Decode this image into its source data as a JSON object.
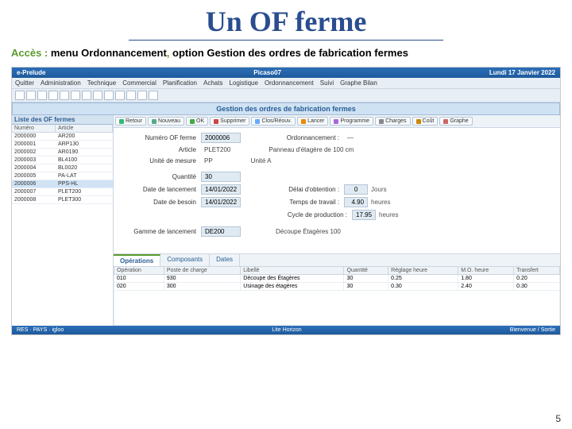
{
  "slide": {
    "title": "Un OF ferme",
    "prefix": "Accès : ",
    "strong1": "menu Ordonnancement",
    "comma": ", ",
    "strong2": "option Gestion des ordres de fabrication fermes",
    "page": "5"
  },
  "topbar": {
    "left": "e-Prelude",
    "center": "Picaso07",
    "right": "Lundi 17 Janvier 2022"
  },
  "menu": [
    "Quitter",
    "Administration",
    "Technique",
    "Commercial",
    "Planification",
    "Achats",
    "Logistique",
    "Ordonnancement",
    "Suivi",
    "Graphe Bilan"
  ],
  "pageHeader": "Gestion des ordres de fabrication fermes",
  "sidebar": {
    "title": "Liste des OF fermes",
    "cols": {
      "c1": "Numéro",
      "c2": "Article"
    },
    "rows": [
      {
        "n": "2000000",
        "a": "AR200"
      },
      {
        "n": "2000001",
        "a": "ARP130"
      },
      {
        "n": "2000002",
        "a": "AR0190"
      },
      {
        "n": "2000003",
        "a": "BL4100"
      },
      {
        "n": "2000004",
        "a": "BL0020"
      },
      {
        "n": "2000005",
        "a": "PA-LAT"
      },
      {
        "n": "2000006",
        "a": "PPS-HL"
      },
      {
        "n": "2000007",
        "a": "PLET200"
      },
      {
        "n": "2000008",
        "a": "PLET300"
      }
    ]
  },
  "toolbar": [
    {
      "label": "Retour",
      "color": "#3b7"
    },
    {
      "label": "Nouveau",
      "color": "#5a8"
    },
    {
      "label": "OK",
      "color": "#4a4"
    },
    {
      "label": "Supprimer",
      "color": "#c44"
    },
    {
      "label": "Clos/Réouv.",
      "color": "#6af"
    },
    {
      "label": "Lancer",
      "color": "#e80"
    },
    {
      "label": "Programme",
      "color": "#a6d"
    },
    {
      "label": "Charges",
      "color": "#888"
    },
    {
      "label": "Coût",
      "color": "#c80"
    },
    {
      "label": "Graphe",
      "color": "#c66"
    }
  ],
  "form": {
    "num_lbl": "Numéro OF ferme",
    "num": "2000006",
    "ord_lbl": "Ordonnancement :",
    "ord": "—",
    "art_lbl": "Article",
    "art": "PLET200",
    "art_desc": "Panneau d'étagère de 100 cm",
    "uom_lbl": "Unité de mesure",
    "uom": "PP",
    "uom_desc": "Unité A",
    "qty_lbl": "Quantité",
    "qty": "30",
    "date_lbl": "Date de lancement",
    "date": "14/01/2022",
    "delai_lbl": "Délai d'obtention :",
    "delai": "0",
    "delai_u": "Jours",
    "besoin_lbl": "Date de besoin",
    "besoin": "14/01/2022",
    "tt_lbl": "Temps de travail :",
    "tt": "4.90",
    "tt_u": "heures",
    "tp_lbl": "Cycle de production :",
    "tp": "17.95",
    "tp_u": "heures",
    "gamme_lbl": "Gamme de lancement",
    "gamme": "DE200",
    "gamme_desc": "Découpe Étagères 100"
  },
  "tabs": [
    "Opérations",
    "Composants",
    "Dates"
  ],
  "opcols": [
    "Opération",
    "Poste de charge",
    "Libellé",
    "Quantité",
    "Réglage heure",
    "M.O. heure",
    "Transfert"
  ],
  "oprows": [
    {
      "op": "010",
      "poste": "930",
      "lib": "Découpe des Étagères",
      "q": "30",
      "reg": "0.25",
      "mo": "1.80",
      "tr": "0.20"
    },
    {
      "op": "020",
      "poste": "300",
      "lib": "Usinage des étagères",
      "q": "30",
      "reg": "0.30",
      "mo": "2.40",
      "tr": "0.30"
    }
  ],
  "status": {
    "left": "RES · PAYS · igloo",
    "center": "Lite Horizon",
    "right": "Bienvenue / Sortie"
  }
}
